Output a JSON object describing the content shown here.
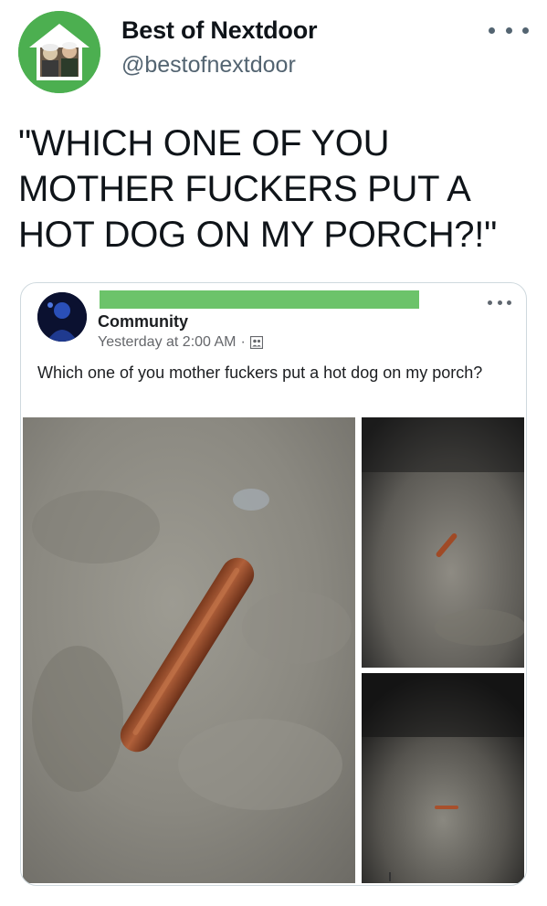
{
  "tweet": {
    "author": {
      "name": "Best of Nextdoor",
      "handle": "@bestofnextdoor",
      "avatar_icon": "house-with-two-muppet-characters"
    },
    "more_icon": "ellipsis-icon",
    "text": "\"WHICH ONE OF YOU\nMOTHER FUCKERS PUT A\nHOT DOG ON MY PORCH?!\""
  },
  "embedded_post": {
    "group_name": "Community",
    "timestamp": "Yesterday at 2:00 AM",
    "separator": "·",
    "audience_icon": "group-icon",
    "more_icon": "ellipsis-icon",
    "text": "Which one of you mother fuckers put a hot dog on my porch?",
    "redaction_color": "#6cc36a",
    "photos": [
      {
        "subject": "hot dog on concrete porch (close up)"
      },
      {
        "subject": "hot dog on dark porch (wide shot)"
      },
      {
        "subject": "hot dog on dark porch (far shot)"
      }
    ]
  },
  "colors": {
    "brand_green": "#4caf50",
    "text_primary": "#0f1419",
    "text_secondary": "#536471",
    "card_border": "#cfd9de"
  }
}
